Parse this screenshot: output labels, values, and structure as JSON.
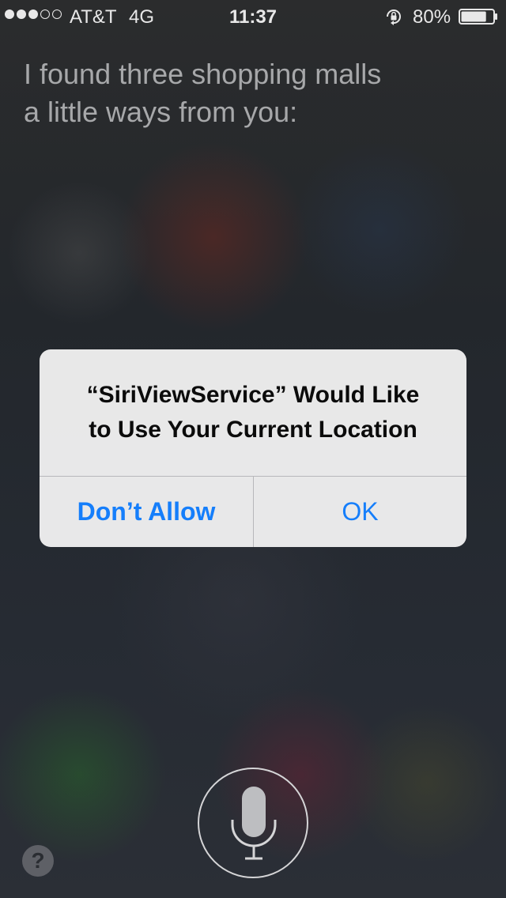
{
  "status_bar": {
    "signal_bars_filled": 3,
    "signal_bars_total": 5,
    "carrier": "AT&T",
    "network": "4G",
    "time": "11:37",
    "battery": "80%",
    "battery_level": 0.8,
    "icons": [
      "signal-dots",
      "rotation-lock-icon",
      "battery-icon"
    ]
  },
  "siri": {
    "response_line1": "I found three shopping malls",
    "response_line2": "a little ways from you:"
  },
  "alert": {
    "title_line1": "“SiriViewService” Would Like",
    "title_line2": "to Use Your Current Location",
    "dont_allow_label": "Don’t Allow",
    "ok_label": "OK",
    "button_color": "#157efb"
  },
  "bottom": {
    "help_label": "?",
    "mic_icon": "microphone-icon"
  }
}
